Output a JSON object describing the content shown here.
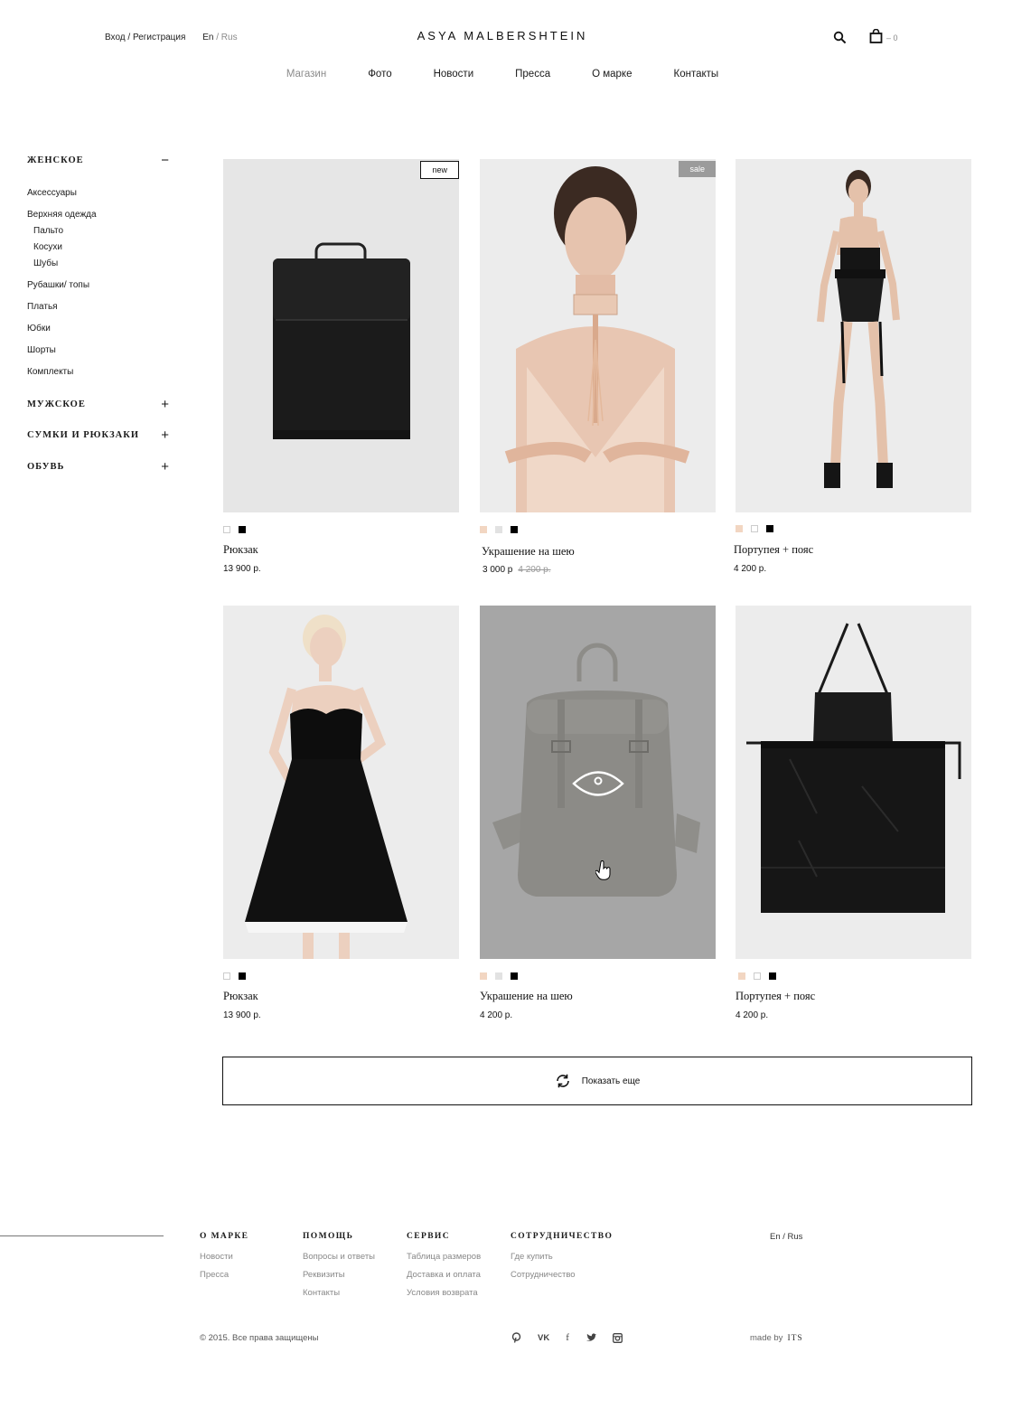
{
  "header": {
    "auth_label": "Вход / Регистрация",
    "lang_en": "En",
    "lang_sep": "/",
    "lang_ru": "Rus",
    "brand": "ASYA MALBERSHTEIN",
    "cart_count": "– 0",
    "nav": [
      "Магазин",
      "Фото",
      "Новости",
      "Пресса",
      "О марке",
      "Контакты"
    ],
    "active_nav": "Магазин"
  },
  "sidebar": {
    "women": {
      "title": "ЖЕНСКОЕ",
      "toggle": "−"
    },
    "subcategories": {
      "accessories": "Аксессуары",
      "outerwear": "Верхняя одежда",
      "coats": "Пальто",
      "leather_jackets": "Косухи",
      "furs": "Шубы",
      "shirts": "Рубашки/ топы",
      "dresses": "Платья",
      "skirts": "Юбки",
      "shorts": "Шорты",
      "sets": "Комплекты"
    },
    "men": {
      "title": "МУЖСКОЕ",
      "toggle": "+"
    },
    "bags": {
      "title": "СУМКИ И РЮКЗАКИ",
      "toggle": "+"
    },
    "shoes": {
      "title": "ОБУВЬ",
      "toggle": "+"
    }
  },
  "products": [
    {
      "name": "Рюкзак",
      "price": "13 900 р.",
      "old_price": "",
      "badge": "new",
      "swatches": [
        "white",
        "black"
      ]
    },
    {
      "name": "Украшение на шею",
      "price": "3 000 р",
      "old_price": "4 200 р.",
      "badge": "sale",
      "swatches": [
        "nude",
        "grey",
        "black"
      ]
    },
    {
      "name": "Портупея + пояс",
      "price": "4 200 р.",
      "old_price": "",
      "badge": "",
      "swatches": [
        "nude",
        "white",
        "black"
      ]
    },
    {
      "name": "Рюкзак",
      "price": "13 900 р.",
      "old_price": "",
      "badge": "",
      "swatches": [
        "white",
        "black"
      ]
    },
    {
      "name": "Украшение на шею",
      "price": "4 200 р.",
      "old_price": "",
      "badge": "",
      "swatches": [
        "nude",
        "grey",
        "black"
      ]
    },
    {
      "name": "Портупея + пояс",
      "price": "4 200 р.",
      "old_price": "",
      "badge": "",
      "swatches": [
        "nude",
        "white",
        "black"
      ]
    }
  ],
  "show_more": "Показать еще",
  "footer": {
    "about": {
      "title": "О МАРКЕ",
      "links": [
        "Новости",
        "Пресса"
      ]
    },
    "help": {
      "title": "ПОМОЩЬ",
      "links": [
        "Вопросы и ответы",
        "Реквизиты",
        "Контакты"
      ]
    },
    "service": {
      "title": "СЕРВИС",
      "links": [
        "Таблица размеров",
        "Доставка и оплата",
        "Условия возврата"
      ]
    },
    "partnership": {
      "title": "СОТРУДНИЧЕСТВО",
      "links": [
        "Где купить",
        "Сотрудничество"
      ]
    },
    "lang": "En / Rus",
    "copyright": "© 2015. Все права защищены",
    "socials": [
      "pinterest-icon",
      "VK",
      "f",
      "twitter-icon",
      "instagram-icon"
    ],
    "made_by_label": "made by",
    "made_by_name": "ITS"
  },
  "colors": {
    "text": "#1a1a1a",
    "muted": "#8a8a8a",
    "sale_badge": "#9b9b9b",
    "swatch_nude": "#f2d6c2"
  }
}
